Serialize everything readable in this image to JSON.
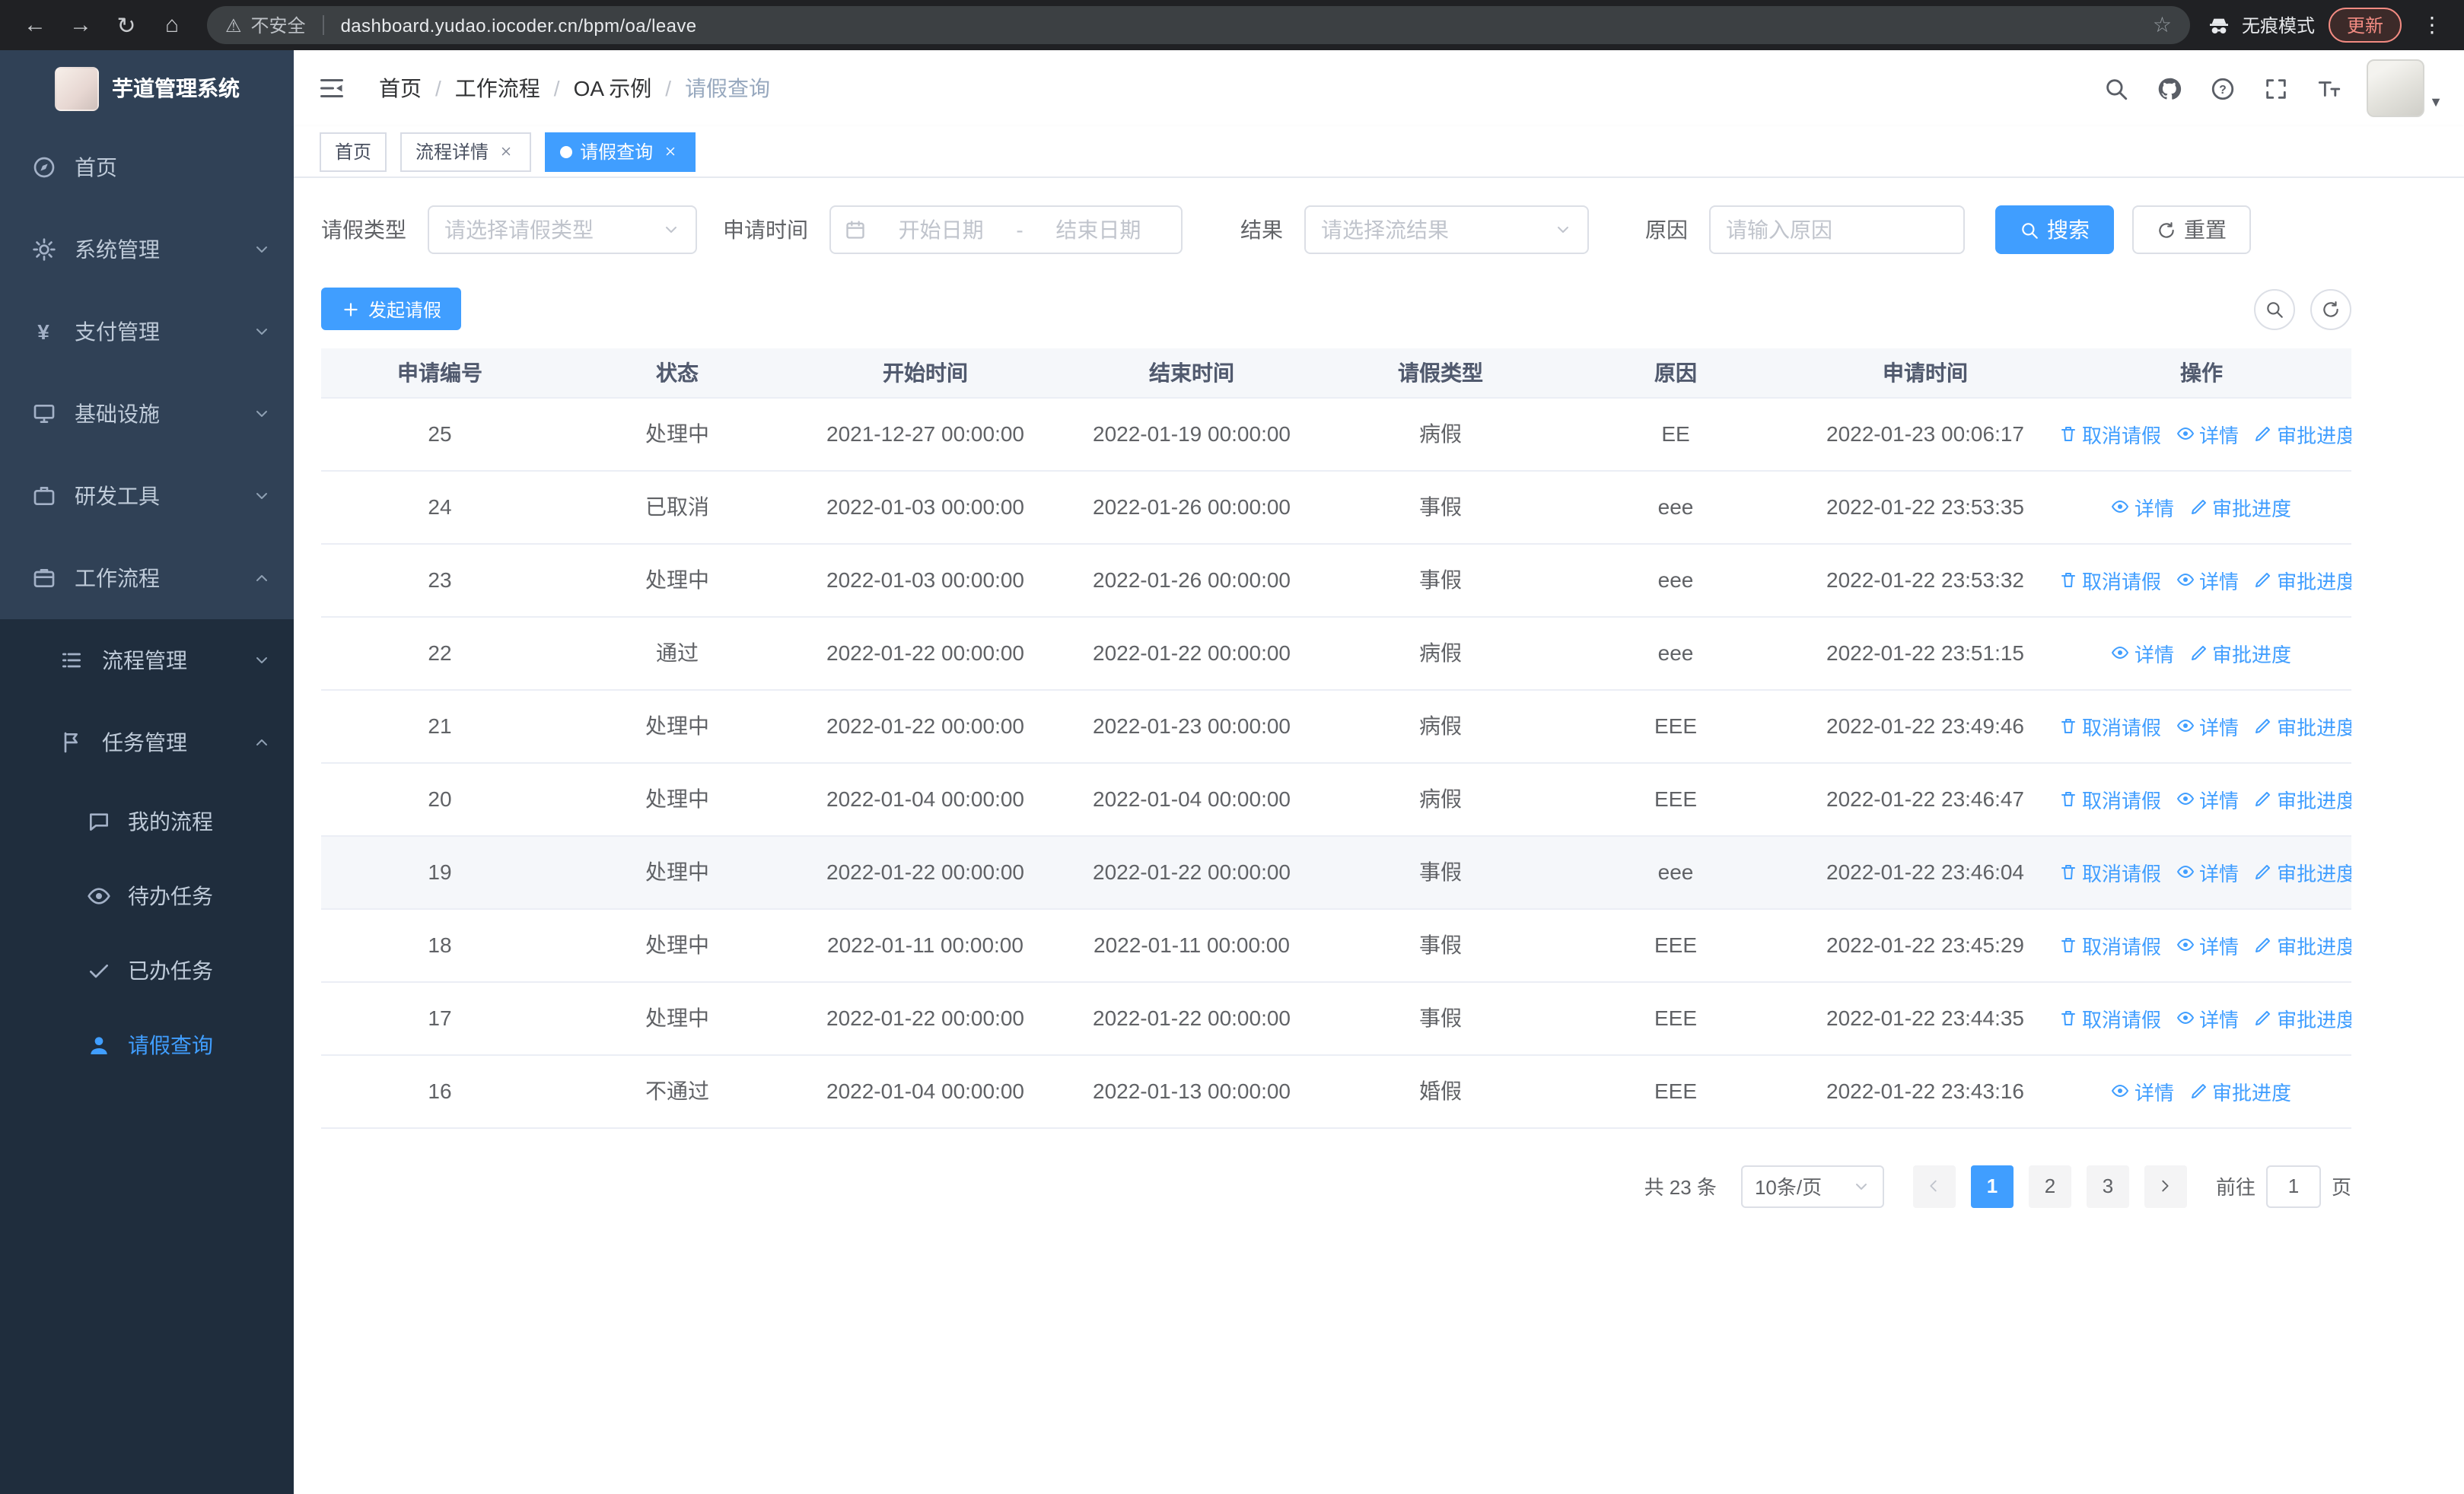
{
  "browser": {
    "security_warning": "不安全",
    "url": "dashboard.yudao.iocoder.cn/bpm/oa/leave",
    "incognito_label": "无痕模式",
    "update_label": "更新"
  },
  "sidebar": {
    "logo_title": "芋道管理系统",
    "menu": [
      {
        "label": "首页",
        "icon": "dashboard"
      },
      {
        "label": "系统管理",
        "icon": "gear"
      },
      {
        "label": "支付管理",
        "icon": "yen"
      },
      {
        "label": "基础设施",
        "icon": "infra"
      },
      {
        "label": "研发工具",
        "icon": "tools"
      },
      {
        "label": "工作流程",
        "icon": "workflow"
      }
    ],
    "submenu": [
      {
        "label": "流程管理",
        "icon": "process"
      },
      {
        "label": "任务管理",
        "icon": "task"
      }
    ],
    "task_children": [
      {
        "label": "我的流程",
        "icon": "chat"
      },
      {
        "label": "待办任务",
        "icon": "eye"
      },
      {
        "label": "已办任务",
        "icon": "done"
      },
      {
        "label": "请假查询",
        "icon": "user"
      }
    ]
  },
  "navbar": {
    "breadcrumb": [
      "首页",
      "工作流程",
      "OA 示例",
      "请假查询"
    ]
  },
  "tabs": [
    {
      "label": "首页"
    },
    {
      "label": "流程详情"
    },
    {
      "label": "请假查询"
    }
  ],
  "filters": {
    "leave_type_label": "请假类型",
    "leave_type_placeholder": "请选择请假类型",
    "apply_time_label": "申请时间",
    "start_placeholder": "开始日期",
    "separator": "-",
    "end_placeholder": "结束日期",
    "result_label": "结果",
    "result_placeholder": "请选择流结果",
    "reason_label": "原因",
    "reason_placeholder": "请输入原因",
    "search_button": "搜索",
    "reset_button": "重置"
  },
  "toolbar": {
    "create_button": "发起请假"
  },
  "table": {
    "columns": [
      "申请编号",
      "状态",
      "开始时间",
      "结束时间",
      "请假类型",
      "原因",
      "申请时间",
      "操作"
    ],
    "actions": {
      "cancel": "取消请假",
      "detail": "详情",
      "progress": "审批进度"
    },
    "rows": [
      {
        "id": "25",
        "status": "处理中",
        "start": "2021-12-27 00:00:00",
        "end": "2022-01-19 00:00:00",
        "type": "病假",
        "reason": "EE",
        "applied": "2022-01-23 00:06:17",
        "cancellable": true,
        "highlighted": false
      },
      {
        "id": "24",
        "status": "已取消",
        "start": "2022-01-03 00:00:00",
        "end": "2022-01-26 00:00:00",
        "type": "事假",
        "reason": "eee",
        "applied": "2022-01-22 23:53:35",
        "cancellable": false,
        "highlighted": false
      },
      {
        "id": "23",
        "status": "处理中",
        "start": "2022-01-03 00:00:00",
        "end": "2022-01-26 00:00:00",
        "type": "事假",
        "reason": "eee",
        "applied": "2022-01-22 23:53:32",
        "cancellable": true,
        "highlighted": false
      },
      {
        "id": "22",
        "status": "通过",
        "start": "2022-01-22 00:00:00",
        "end": "2022-01-22 00:00:00",
        "type": "病假",
        "reason": "eee",
        "applied": "2022-01-22 23:51:15",
        "cancellable": false,
        "highlighted": false
      },
      {
        "id": "21",
        "status": "处理中",
        "start": "2022-01-22 00:00:00",
        "end": "2022-01-23 00:00:00",
        "type": "病假",
        "reason": "EEE",
        "applied": "2022-01-22 23:49:46",
        "cancellable": true,
        "highlighted": false
      },
      {
        "id": "20",
        "status": "处理中",
        "start": "2022-01-04 00:00:00",
        "end": "2022-01-04 00:00:00",
        "type": "病假",
        "reason": "EEE",
        "applied": "2022-01-22 23:46:47",
        "cancellable": true,
        "highlighted": false
      },
      {
        "id": "19",
        "status": "处理中",
        "start": "2022-01-22 00:00:00",
        "end": "2022-01-22 00:00:00",
        "type": "事假",
        "reason": "eee",
        "applied": "2022-01-22 23:46:04",
        "cancellable": true,
        "highlighted": true
      },
      {
        "id": "18",
        "status": "处理中",
        "start": "2022-01-11 00:00:00",
        "end": "2022-01-11 00:00:00",
        "type": "事假",
        "reason": "EEE",
        "applied": "2022-01-22 23:45:29",
        "cancellable": true,
        "highlighted": false
      },
      {
        "id": "17",
        "status": "处理中",
        "start": "2022-01-22 00:00:00",
        "end": "2022-01-22 00:00:00",
        "type": "事假",
        "reason": "EEE",
        "applied": "2022-01-22 23:44:35",
        "cancellable": true,
        "highlighted": false
      },
      {
        "id": "16",
        "status": "不通过",
        "start": "2022-01-04 00:00:00",
        "end": "2022-01-13 00:00:00",
        "type": "婚假",
        "reason": "EEE",
        "applied": "2022-01-22 23:43:16",
        "cancellable": false,
        "highlighted": false
      }
    ]
  },
  "pagination": {
    "total_text": "共 23 条",
    "page_size": "10条/页",
    "pages": [
      "1",
      "2",
      "3"
    ],
    "active_page": "1",
    "goto_label": "前往",
    "goto_value": "1",
    "page_unit": "页"
  },
  "colors": {
    "primary": "#409eff",
    "sidebar_bg": "#304156",
    "submenu_bg": "#1f2d3d",
    "table_header_bg": "#f5f7fa"
  }
}
